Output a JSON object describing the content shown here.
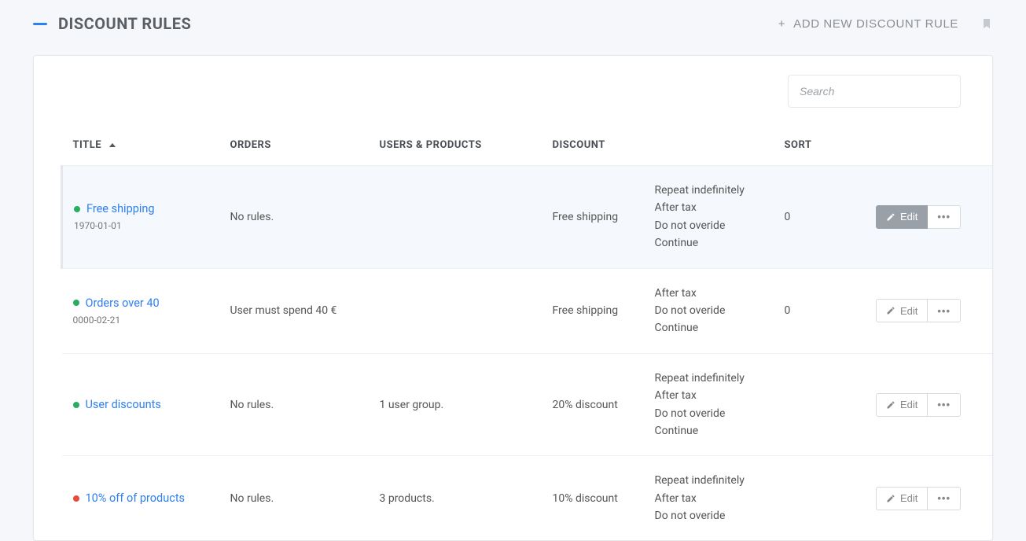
{
  "header": {
    "title": "DISCOUNT RULES",
    "add_button": "ADD NEW DISCOUNT RULE"
  },
  "search": {
    "placeholder": "Search",
    "value": ""
  },
  "columns": {
    "title": "TITLE",
    "orders": "ORDERS",
    "users": "USERS & PRODUCTS",
    "discount": "DISCOUNT",
    "sort": "SORT"
  },
  "actions": {
    "edit": "Edit"
  },
  "rows": [
    {
      "status": "green",
      "title": "Free shipping",
      "date": "1970-01-01",
      "orders": "No rules.",
      "users": "",
      "discount": "Free shipping",
      "rule1": "Repeat indefinitely",
      "rule2": "After tax",
      "rule3": "Do not overide",
      "rule4": "Continue",
      "sort": "0",
      "selected": true
    },
    {
      "status": "green",
      "title": "Orders over 40",
      "date": "0000-02-21",
      "orders": "User must spend 40 €",
      "users": "",
      "discount": "Free shipping",
      "rule1": "After tax",
      "rule2": "Do not overide",
      "rule3": "Continue",
      "rule4": "",
      "sort": "0",
      "selected": false
    },
    {
      "status": "green",
      "title": "User discounts",
      "date": "",
      "orders": "No rules.",
      "users": "1 user group.",
      "discount": "20% discount",
      "rule1": "Repeat indefinitely",
      "rule2": "After tax",
      "rule3": "Do not overide",
      "rule4": "Continue",
      "sort": "",
      "selected": false
    },
    {
      "status": "red",
      "title": "10% off of products",
      "date": "",
      "orders": "No rules.",
      "users": "3 products.",
      "discount": "10% discount",
      "rule1": "Repeat indefinitely",
      "rule2": "After tax",
      "rule3": "Do not overide",
      "rule4": "",
      "sort": "",
      "selected": false
    }
  ]
}
